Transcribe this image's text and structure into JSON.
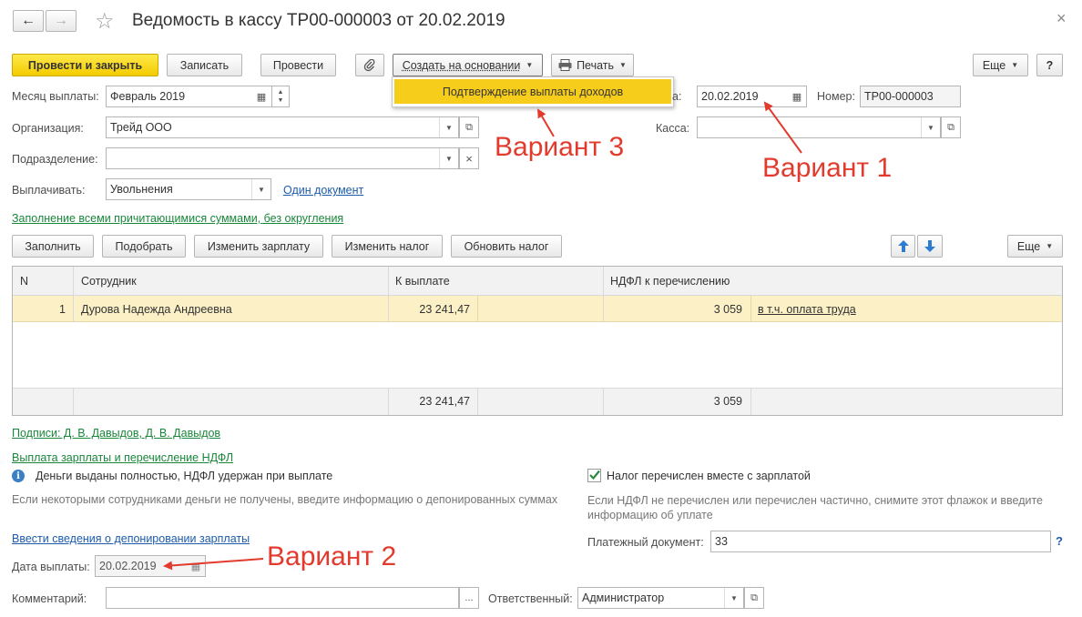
{
  "window": {
    "title": "Ведомость в кассу ТР00-000003 от 20.02.2019",
    "back_glyph": "←",
    "forward_glyph": "→",
    "star_glyph": "☆",
    "close_glyph": "×"
  },
  "toolbar": {
    "post_close": "Провести и закрыть",
    "save": "Записать",
    "post": "Провести",
    "create_based": "Создать на основании",
    "print": "Печать",
    "more": "Еще",
    "help": "?"
  },
  "dropdown_menu": {
    "item": "Подтверждение выплаты доходов"
  },
  "form": {
    "month_label": "Месяц выплаты:",
    "month_value": "Февраль 2019",
    "date_label": "а:",
    "date_value": "20.02.2019",
    "number_label": "Номер:",
    "number_value": "ТР00-000003",
    "org_label": "Организация:",
    "org_value": "Трейд ООО",
    "cash_label": "Касса:",
    "cash_value": "",
    "division_label": "Подразделение:",
    "division_value": "",
    "pay_label": "Выплачивать:",
    "pay_value": "Увольнения",
    "one_doc_link": "Один документ",
    "fill_mode_link": "Заполнение всеми причитающимися суммами, без округления"
  },
  "table_toolbar": {
    "fill": "Заполнить",
    "pick": "Подобрать",
    "change_salary": "Изменить зарплату",
    "change_tax": "Изменить налог",
    "refresh_tax": "Обновить налог",
    "more": "Еще"
  },
  "table": {
    "headers": {
      "n": "N",
      "employee": "Сотрудник",
      "pay": "К выплате",
      "ndfl": "НДФЛ к перечислению"
    },
    "rows": [
      {
        "n": "1",
        "employee": "Дурова Надежда Андреевна",
        "pay": "23 241,47",
        "ndfl": "3 059",
        "ndfl_link": "в т.ч. оплата труда"
      }
    ],
    "totals": {
      "pay": "23 241,47",
      "ndfl": "3 059"
    }
  },
  "signatures_link": "Подписи: Д. В. Давыдов, Д. В. Давыдов",
  "payout_section_link": "Выплата зарплаты и перечисление НДФЛ",
  "info_icon_glyph": "i",
  "info_text": "Деньги выданы полностью, НДФЛ удержан при выплате",
  "info_hint": "Если некоторыми сотрудниками деньги не получены, введите информацию о депонированных суммах",
  "deposit_link": "Ввести сведения о депонировании зарплаты",
  "tax_checkbox": {
    "label": "Налог перечислен вместе с зарплатой",
    "checked": true,
    "hint": "Если НДФЛ не перечислен или перечислен частично, снимите этот флажок и введите информацию об уплате"
  },
  "payment_doc_label": "Платежный документ:",
  "payment_doc_value": "33",
  "payment_help": "?",
  "pay_date_label": "Дата выплаты:",
  "pay_date_value": "20.02.2019",
  "comment_label": "Комментарий:",
  "comment_value": "",
  "comment_btn": "...",
  "responsible_label": "Ответственный:",
  "responsible_value": "Администратор",
  "annotations": {
    "v1": "Вариант 1",
    "v2": "Вариант 2",
    "v3": "Вариант 3"
  },
  "colors": {
    "accent_yellow": "#f5d312",
    "row_highlight": "#fbf0c6",
    "annotation_red": "#e23b2e",
    "link_green": "#19873b",
    "link_blue": "#1d5cab"
  }
}
